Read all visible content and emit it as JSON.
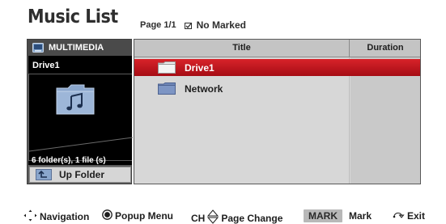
{
  "header": {
    "title": "Music List",
    "page_info": "Page 1/1",
    "marked_status": "No Marked"
  },
  "left_panel": {
    "source_label": "MULTIMEDIA",
    "source_icon": "multimedia-icon",
    "current_location": "Drive1",
    "preview_icon": "music-folder-icon",
    "counts": "6 folder(s), 1 file (s)",
    "up_folder_label": "Up Folder"
  },
  "list": {
    "columns": [
      "Title",
      "Duration"
    ],
    "rows": [
      {
        "name": "Drive1",
        "type": "folder",
        "selected": true,
        "duration": ""
      },
      {
        "name": "Network",
        "type": "folder",
        "selected": false,
        "duration": ""
      }
    ]
  },
  "footer": {
    "navigation": "Navigation",
    "popup_menu": "Popup Menu",
    "ch_label": "CH",
    "page_change": "Page Change",
    "mark_key": "MARK",
    "mark": "Mark",
    "exit": "Exit"
  },
  "colors": {
    "selected_row": "#c8161d",
    "panel_dark": "#5a5a5a",
    "list_bg": "#d7d7d7",
    "folder_blue": "#6f87b8"
  }
}
